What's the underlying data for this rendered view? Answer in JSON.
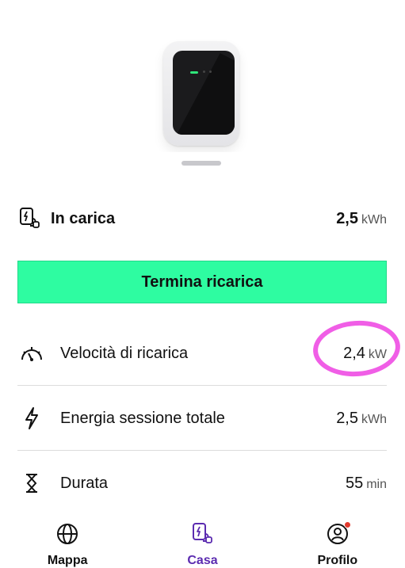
{
  "colors": {
    "accent_button": "#2efca1",
    "active_tab": "#5b2bb0",
    "highlight_annotation": "#f05ee6",
    "notification_badge": "#e23a2e"
  },
  "status": {
    "label": "In carica",
    "value": "2,5",
    "unit": "kWh",
    "icon": "charging-station-icon"
  },
  "actions": {
    "stop_label": "Termina ricarica"
  },
  "stats": [
    {
      "icon": "speedometer-icon",
      "label": "Velocità di ricarica",
      "value": "2,4",
      "unit": "kW"
    },
    {
      "icon": "lightning-icon",
      "label": "Energia sessione totale",
      "value": "2,5",
      "unit": "kWh"
    },
    {
      "icon": "hourglass-icon",
      "label": "Durata",
      "value": "55",
      "unit": "min"
    }
  ],
  "tabs": [
    {
      "label": "Mappa",
      "icon": "globe-icon",
      "active": false
    },
    {
      "label": "Casa",
      "icon": "home-charger-icon",
      "active": true
    },
    {
      "label": "Profilo",
      "icon": "profile-icon",
      "active": false,
      "badge": true
    }
  ]
}
